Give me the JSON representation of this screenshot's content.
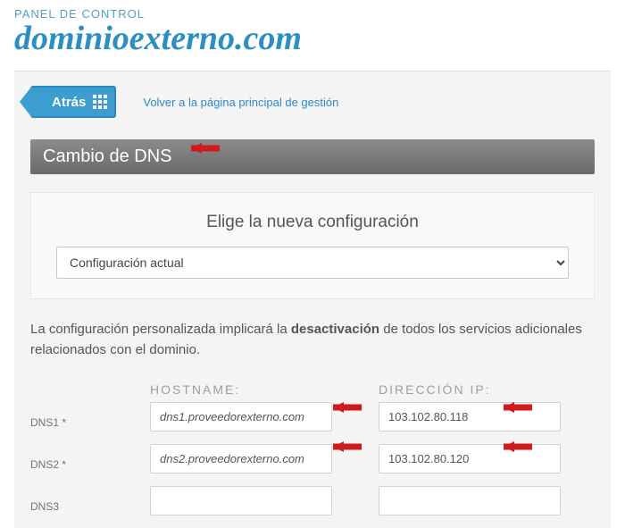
{
  "header": {
    "subtitle": "PANEL DE CONTROL",
    "domain": "dominioexterno.com"
  },
  "nav": {
    "back_label": "Atrás",
    "back_link": "Volver a la página principal de gestión"
  },
  "section": {
    "title": "Cambio de DNS"
  },
  "config": {
    "title": "Elige la nueva configuración",
    "selected": "Configuración actual"
  },
  "warning": {
    "pre": "La configuración personalizada implicará la ",
    "bold": "desactivación",
    "post": " de todos los servicios adicionales relacionados con el dominio."
  },
  "columns": {
    "hostname": "HOSTNAME:",
    "ip": "DIRECCIÓN IP:"
  },
  "dns": [
    {
      "label": "DNS1 *",
      "host": "dns1.proveedorexterno.com",
      "ip": "103.102.80.118"
    },
    {
      "label": "DNS2 *",
      "host": "dns2.proveedorexterno.com",
      "ip": "103.102.80.120"
    },
    {
      "label": "DNS3",
      "host": "",
      "ip": ""
    }
  ]
}
